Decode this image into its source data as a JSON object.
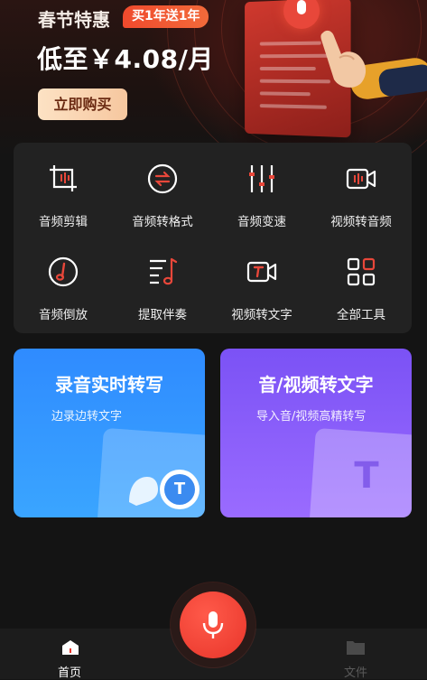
{
  "promo": {
    "title": "春节特惠",
    "badge": "买1年送1年",
    "price": "低至￥4.08/月",
    "buy_label": "立即购买"
  },
  "tools": [
    {
      "label": "音频剪辑",
      "icon": "audio-crop-icon"
    },
    {
      "label": "音频转格式",
      "icon": "format-convert-icon"
    },
    {
      "label": "音频变速",
      "icon": "speed-sliders-icon"
    },
    {
      "label": "视频转音频",
      "icon": "video-to-audio-icon"
    },
    {
      "label": "音频倒放",
      "icon": "reverse-note-icon"
    },
    {
      "label": "提取伴奏",
      "icon": "extract-accompaniment-icon"
    },
    {
      "label": "视频转文字",
      "icon": "video-to-text-icon"
    },
    {
      "label": "全部工具",
      "icon": "all-tools-grid-icon"
    }
  ],
  "cards": {
    "record": {
      "title": "录音实时转写",
      "subtitle": "边录边转文字",
      "icon_letter": "T"
    },
    "video": {
      "title": "音/视频转文字",
      "subtitle": "导入音/视频高精转写",
      "icon_letter": "T"
    }
  },
  "tabbar": {
    "home_label": "首页",
    "files_label": "文件",
    "active_color": "#ffffff",
    "inactive_color": "#5a5a5a"
  },
  "colors": {
    "accent_red": "#e8352a",
    "record_card": "#2f8bff",
    "video_card": "#7b52f5",
    "icon_red": "#e8473a"
  }
}
